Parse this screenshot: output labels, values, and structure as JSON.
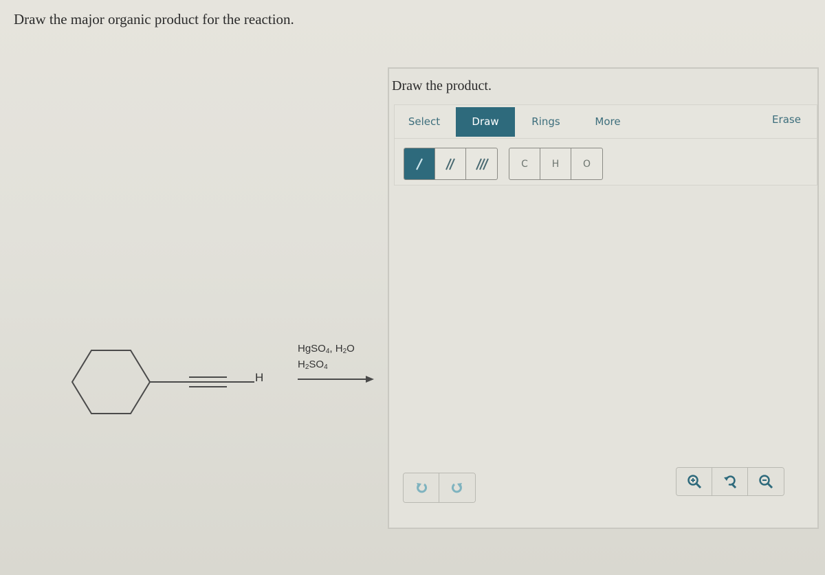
{
  "question": {
    "prompt": "Draw the major organic product for the reaction."
  },
  "reaction": {
    "reactant_name": "cyclohexylacetylene",
    "terminal_atom": "H",
    "reagents_line1_parts": [
      "HgSO",
      "4",
      ", H",
      "2",
      "O"
    ],
    "reagents_line2_parts": [
      "H",
      "2",
      "SO",
      "4"
    ]
  },
  "editor": {
    "title": "Draw the product.",
    "tabs": [
      {
        "label": "Select",
        "active": false
      },
      {
        "label": "Draw",
        "active": true
      },
      {
        "label": "Rings",
        "active": false
      },
      {
        "label": "More",
        "active": false
      }
    ],
    "erase_label": "Erase",
    "bond_tools": [
      {
        "name": "single-bond",
        "active": true
      },
      {
        "name": "double-bond",
        "active": false
      },
      {
        "name": "triple-bond",
        "active": false
      }
    ],
    "atom_tools": [
      "C",
      "H",
      "O"
    ],
    "history": [
      "undo-icon",
      "redo-icon"
    ],
    "zoom_tools": [
      "zoom-in-icon",
      "reset-zoom-icon",
      "zoom-out-icon"
    ],
    "accent_color": "#2e6a7c"
  }
}
